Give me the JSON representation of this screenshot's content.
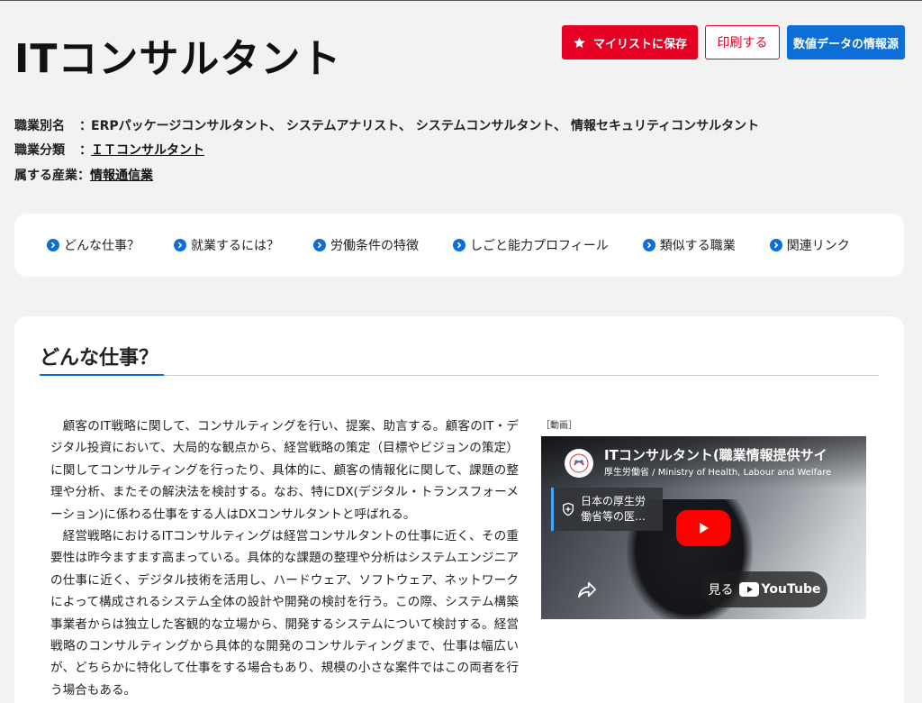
{
  "page": {
    "title": "ITコンサルタント"
  },
  "actions": {
    "mylist_label": "マイリストに保存",
    "print_label": "印刷する",
    "source_label": "数値データの情報源"
  },
  "meta": {
    "aliases_label": "職業別名",
    "aliases_value": "ERPパッケージコンサルタント、 システムアナリスト、 システムコンサルタント、 情報セキュリティコンサルタント",
    "category_label": "職業分類",
    "category_value": "ＩＴコンサルタント",
    "industry_label": "属する産業",
    "industry_value": "情報通信業",
    "separator": "："
  },
  "nav": {
    "items": [
      {
        "label": "どんな仕事？"
      },
      {
        "label": "就業するには？"
      },
      {
        "label": "労働条件の特徴"
      },
      {
        "label": "しごと能力プロフィール"
      },
      {
        "label": "類似する職業"
      },
      {
        "label": "関連リンク"
      }
    ]
  },
  "section": {
    "title": "どんな仕事？",
    "paragraphs": [
      "顧客のIT戦略に関して、コンサルティングを行い、提案、助言する。顧客のIT・デジタル投資において、大局的な観点から、経営戦略の策定（目標やビジョンの策定）に関してコンサルティングを行ったり、具体的に、顧客の情報化に関して、課題の整理や分析、またその解決法を検討する。なお、特にDX(デジタル・トランスフォーメーション)に係わる仕事をする人はDXコンサルタントと呼ばれる。",
      "経営戦略におけるITコンサルティングは経営コンサルタントの仕事に近く、その重要性は昨今ますます高まっている。具体的な課題の整理や分析はシステムエンジニアの仕事に近く、デジタル技術を活用し、ハードウェア、ソフトウェア、ネットワークによって構成されるシステム全体の設計や開発の検討を行う。この際、システム構築事業者からは独立した客観的な立場から、開発するシステムについて検討する。経営戦略のコンサルティングから具体的な開発のコンサルティングまで、仕事は幅広いが、どちらかに特化して仕事をする場合もあり、規模の小さな案件ではこの両者を行う場合もある。"
    ]
  },
  "video": {
    "label": "［動画］",
    "title": "ITコンサルタント(職業情報提供サイ",
    "channel": "厚生労働省 / Ministry of Health, Labour and Welfare",
    "info_line1": "日本の厚生労",
    "info_line2": "働省等の医…",
    "watch_label": "見る",
    "youtube_label": "YouTube"
  },
  "colors": {
    "accent_red": "#e60023",
    "accent_blue": "#0d6ed8"
  }
}
